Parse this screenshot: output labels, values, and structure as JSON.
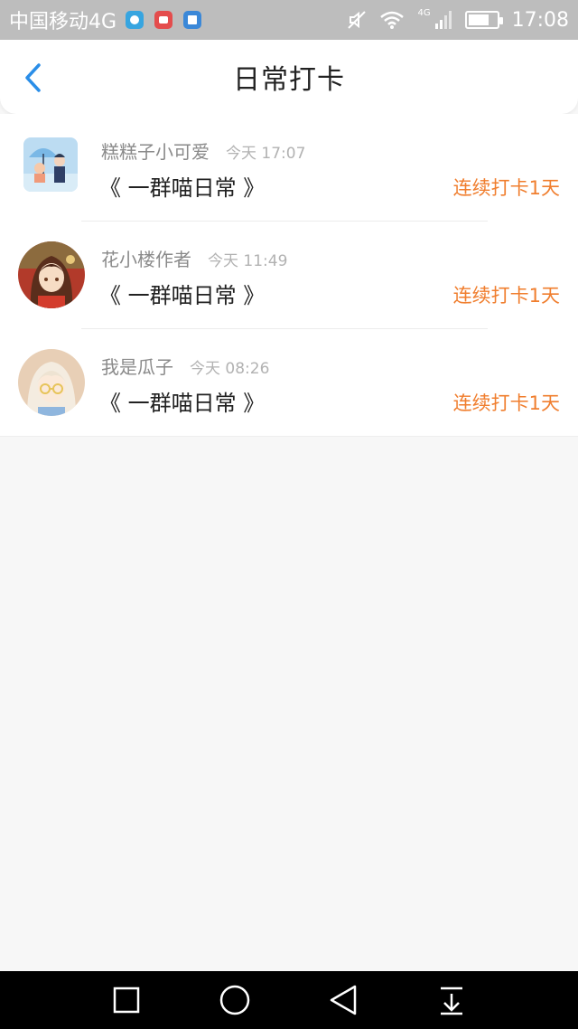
{
  "status_bar": {
    "carrier": "中国移动4G",
    "net_label": "4G",
    "time": "17:08"
  },
  "header": {
    "title": "日常打卡"
  },
  "list": [
    {
      "name": "糕糕子小可爱",
      "time": "今天 17:07",
      "book": "《 一群喵日常 》",
      "streak": "连续打卡1天"
    },
    {
      "name": "花小楼作者",
      "time": "今天 11:49",
      "book": "《 一群喵日常 》",
      "streak": "连续打卡1天"
    },
    {
      "name": "我是瓜子",
      "time": "今天 08:26",
      "book": "《 一群喵日常 》",
      "streak": "连续打卡1天"
    }
  ],
  "colors": {
    "accent_orange": "#f07e2e",
    "back_blue": "#2a8ee8",
    "status_bar_bg": "#bdbdbd"
  }
}
